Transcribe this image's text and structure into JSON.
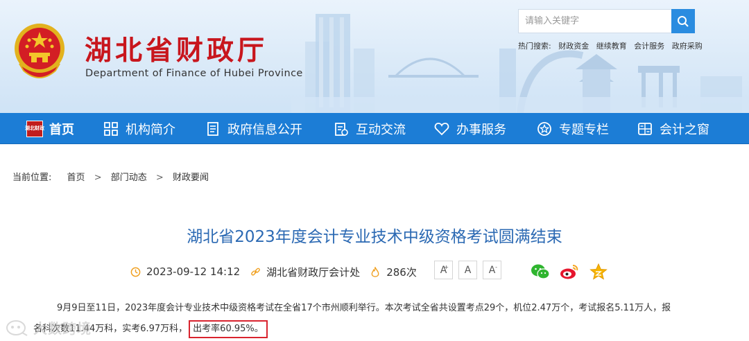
{
  "header": {
    "title": "湖北省财政厅",
    "subtitle": "Department of Finance of Hubei Province",
    "search_placeholder": "请输入关键字",
    "hot_label": "热门搜索:",
    "hot_links": [
      "财政资金",
      "继续教育",
      "会计服务",
      "政府采购"
    ]
  },
  "nav": {
    "home_badge": "湖北财政",
    "items": [
      "首页",
      "机构简介",
      "政府信息公开",
      "互动交流",
      "办事服务",
      "专题专栏",
      "会计之窗"
    ]
  },
  "breadcrumb": {
    "label": "当前位置:",
    "items": [
      "首页",
      "部门动态",
      "财政要闻"
    ],
    "separator": ">"
  },
  "article": {
    "title": "湖北省2023年度会计专业技术中级资格考试圆满结束",
    "datetime": "2023-09-12 14:12",
    "source": "湖北省财政厅会计处",
    "views": "286次",
    "font_buttons": [
      "A",
      "A",
      "A"
    ],
    "font_button_marks": [
      "+",
      "",
      "-"
    ],
    "para_line1": "9月9日至11日，2023年度会计专业技术中级资格考试在全省17个市州顺利举行。本次考试全省共设置考点29个，机位2.47万个，考试报名5.11万人，报",
    "para_line2": "名科次数11.44万科，实考6.97万科，",
    "para_highlight": "出考率60.95%。"
  },
  "watermark": "大数跨境",
  "colors": {
    "brand_red": "#c8161d",
    "nav_blue": "#1c7dd6",
    "title_blue": "#2b69b3",
    "highlight_red": "#d9232e"
  }
}
